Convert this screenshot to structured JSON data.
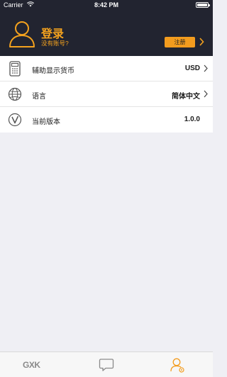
{
  "status_bar": {
    "carrier": "Carrier",
    "time": "8:42 PM"
  },
  "header": {
    "title": "登录",
    "subtitle": "没有账号?",
    "register_label": "注册"
  },
  "settings": [
    {
      "label": "辅助显示货币",
      "value": "USD",
      "icon": "calculator-icon",
      "has_arrow": true
    },
    {
      "label": "语言",
      "value": "简体中文",
      "icon": "globe-icon",
      "has_arrow": true
    },
    {
      "label": "当前版本",
      "value": "1.0.0",
      "icon": "version-icon",
      "has_arrow": false
    }
  ],
  "tabbar": {
    "home_label": "GXK",
    "items": [
      "home-tab",
      "messages-tab",
      "profile-tab"
    ],
    "active": "profile-tab"
  },
  "colors": {
    "header_bg": "#222430",
    "accent": "#f39c1e",
    "page_bg": "#efeff4"
  }
}
